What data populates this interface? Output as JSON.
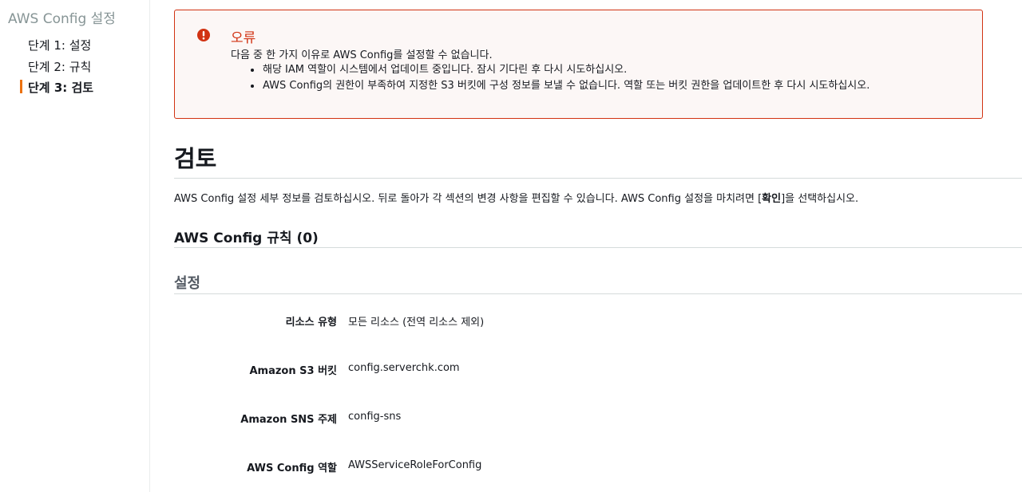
{
  "sidebar": {
    "title": "AWS Config 설정",
    "steps": [
      {
        "label": "단계 1: 설정"
      },
      {
        "label": "단계 2: 규칙"
      },
      {
        "label": "단계 3: 검토"
      }
    ]
  },
  "alert": {
    "title": "오류",
    "description": "다음 중 한 가지 이유로 AWS Config를 설정할 수 없습니다.",
    "reasons": [
      "해당 IAM 역할이 시스템에서 업데이트 중입니다. 잠시 기다린 후 다시 시도하십시오.",
      "AWS Config의 권한이 부족하여 지정한 S3 버킷에 구성 정보를 보낼 수 없습니다. 역할 또는 버킷 권한을 업데이트한 후 다시 시도하십시오."
    ],
    "color": "#d13212"
  },
  "review": {
    "title": "검토",
    "intro_before": "AWS Config 설정 세부 정보를 검토하십시오. 뒤로 돌아가 각 섹션의 변경 사항을 편집할 수 있습니다. AWS Config 설정을 마치려면 [",
    "intro_bold": "확인",
    "intro_after": "]을 선택하십시오.",
    "rules_heading": "AWS Config 규칙 (0)",
    "settings_heading": "설정",
    "settings": [
      {
        "label": "리소스 유형",
        "value": "모든 리소스 (전역 리소스 제외)"
      },
      {
        "label": "Amazon S3 버킷",
        "value": "config.serverchk.com"
      },
      {
        "label": "Amazon SNS 주제",
        "value": "config-sns"
      },
      {
        "label": "AWS Config 역할",
        "value": "AWSServiceRoleForConfig"
      }
    ]
  },
  "colors": {
    "accent": "#ec7211",
    "error": "#d13212"
  }
}
